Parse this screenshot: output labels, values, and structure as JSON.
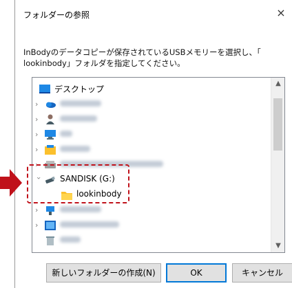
{
  "dialog": {
    "title": "フォルダーの参照",
    "close_label": "×",
    "instructions_line1": "InBodyのデータコピーが保存されているUSBメモリーを選択し、「",
    "instructions_line2": "lookinbody」フォルダを指定してください。"
  },
  "tree": {
    "items": [
      {
        "label": "デスクトップ",
        "icon": "desktop-icon"
      },
      {
        "label": "",
        "icon": "onedrive-icon",
        "redacted": true
      },
      {
        "label": "",
        "icon": "user-icon",
        "redacted": true
      },
      {
        "label": "",
        "icon": "pc-icon",
        "redacted": true
      },
      {
        "label": "",
        "icon": "library-icon",
        "redacted": true
      },
      {
        "label": "",
        "icon": "drive-icon",
        "redacted": true
      },
      {
        "label": "SANDISK (G:)",
        "icon": "usb-drive-icon"
      },
      {
        "label": "lookinbody",
        "icon": "folder-icon"
      },
      {
        "label": "",
        "icon": "network-icon",
        "redacted": true
      },
      {
        "label": "",
        "icon": "control-panel-icon",
        "redacted": true
      },
      {
        "label": "",
        "icon": "recycle-bin-icon",
        "redacted": true
      }
    ]
  },
  "buttons": {
    "new_folder": "新しいフォルダーの作成(N)",
    "ok": "OK",
    "cancel": "キャンセル"
  },
  "colors": {
    "highlight": "#c0111a",
    "accent": "#0078d7"
  }
}
